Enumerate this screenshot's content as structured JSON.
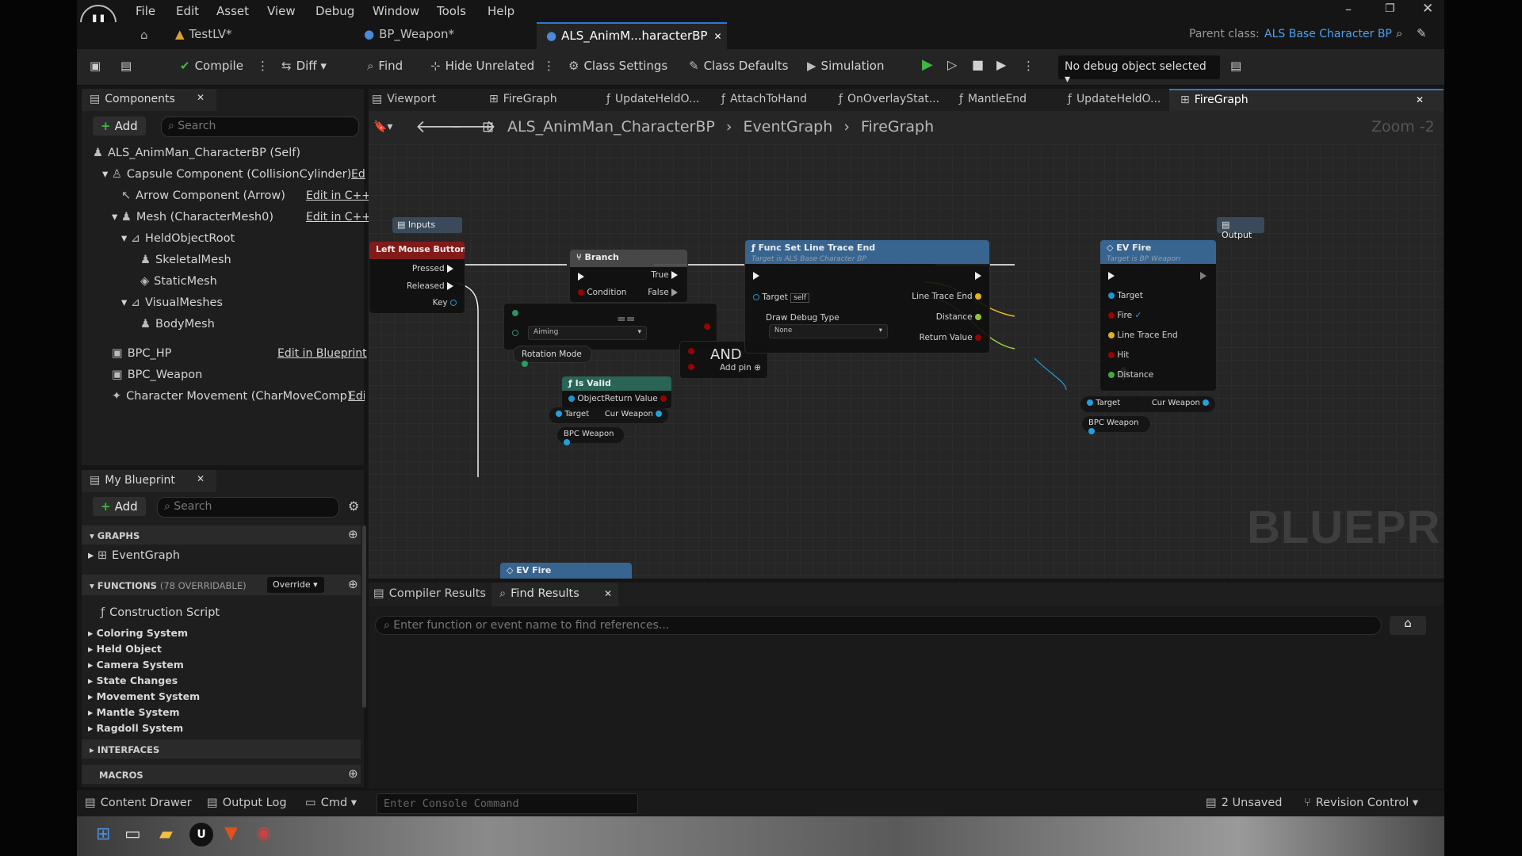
{
  "menu": [
    "File",
    "Edit",
    "Asset",
    "View",
    "Debug",
    "Window",
    "Tools",
    "Help"
  ],
  "tabs": {
    "home": "",
    "testlv": "TestLV*",
    "bp_weapon": "BP_Weapon*",
    "als": "ALS_AnimM...haracterBP",
    "parent_label": "Parent class:",
    "parent_value": "ALS Base Character BP"
  },
  "toolbar": {
    "compile": "Compile",
    "diff": "Diff",
    "find": "Find",
    "hide_unrelated": "Hide Unrelated",
    "class_settings": "Class Settings",
    "class_defaults": "Class Defaults",
    "simulation": "Simulation",
    "debug_object": "No debug object selected"
  },
  "components": {
    "title": "Components",
    "add": "Add",
    "search_placeholder": "Search",
    "items": [
      {
        "label": "ALS_AnimMan_CharacterBP (Self)",
        "action": ""
      },
      {
        "label": "Capsule Component (CollisionCylinder)",
        "action": "Ed"
      },
      {
        "label": "Arrow Component (Arrow)",
        "action": "Edit in C++"
      },
      {
        "label": "Mesh (CharacterMesh0)",
        "action": "Edit in C++"
      },
      {
        "label": "HeldObjectRoot",
        "action": ""
      },
      {
        "label": "SkeletalMesh",
        "action": ""
      },
      {
        "label": "StaticMesh",
        "action": ""
      },
      {
        "label": "VisualMeshes",
        "action": ""
      },
      {
        "label": "BodyMesh",
        "action": ""
      },
      {
        "label": "BPC_HP",
        "action": "Edit in Blueprint"
      },
      {
        "label": "BPC_Weapon",
        "action": ""
      },
      {
        "label": "Character Movement (CharMoveComp)",
        "action": "Edi"
      }
    ]
  },
  "myblueprint": {
    "title": "My Blueprint",
    "add": "Add",
    "search_placeholder": "Search",
    "graphs": "GRAPHS",
    "eventgraph": "EventGraph",
    "functions": "FUNCTIONS",
    "functions_count": "(78 OVERRIDABLE)",
    "override": "Override",
    "construction": "Construction Script",
    "categories": [
      "Coloring System",
      "Held Object",
      "Camera System",
      "State Changes",
      "Movement System",
      "Mantle System",
      "Ragdoll System"
    ],
    "interfaces": "INTERFACES",
    "macros": "MACROS"
  },
  "graph_tabs": [
    "Viewport",
    "FireGraph",
    "UpdateHeldO...",
    "AttachToHand",
    "OnOverlayStat...",
    "MantleEnd",
    "UpdateHeldO...",
    "FireGraph"
  ],
  "breadcrumb": {
    "a": "ALS_AnimMan_CharacterBP",
    "b": "EventGraph",
    "c": "FireGraph",
    "zoom": "Zoom -2"
  },
  "nodes": {
    "inputs": "Inputs",
    "outputs": "Output",
    "lmb": {
      "title": "Left Mouse Button",
      "pressed": "Pressed",
      "released": "Released",
      "key": "Key"
    },
    "branch": {
      "title": "Branch",
      "true": "True",
      "condition": "Condition",
      "false": "False"
    },
    "aiming": "Aiming",
    "rotation_mode": "Rotation Mode",
    "and": {
      "title": "AND",
      "add_pin": "Add pin"
    },
    "isvalid": {
      "title": "Is Valid",
      "object": "Object",
      "return": "Return Value",
      "target": "Target",
      "cur_weapon": "Cur Weapon",
      "bpc_weapon": "BPC Weapon"
    },
    "trace": {
      "title": "Func Set Line Trace End",
      "subtitle": "Target is ALS Base Character BP",
      "target": "Target",
      "self": "self",
      "draw_debug": "Draw Debug Type",
      "none": "None",
      "line_trace_end": "Line Trace End",
      "distance": "Distance",
      "return_value": "Return Value"
    },
    "evfire": {
      "title": "EV Fire",
      "subtitle": "Target is BP Weapon",
      "target": "Target",
      "fire": "Fire",
      "line_trace_end": "Line Trace End",
      "hit": "Hit",
      "distance": "Distance"
    },
    "getter": {
      "target": "Target",
      "cur_weapon": "Cur Weapon",
      "bpc_weapon": "BPC Weapon"
    },
    "evfire2": "EV Fire",
    "watermark": "BLUEPRINT"
  },
  "bottom": {
    "compiler_results": "Compiler Results",
    "find_results": "Find Results",
    "find_placeholder": "Enter function or event name to find references..."
  },
  "status": {
    "content_drawer": "Content Drawer",
    "output_log": "Output Log",
    "cmd": "Cmd",
    "console_placeholder": "Enter Console Command",
    "unsaved": "2 Unsaved",
    "revision": "Revision Control"
  },
  "colors": {
    "exec": "#ffffff",
    "object": "#1fa0e0",
    "bool": "#a00000",
    "float": "#9bd13a",
    "vector": "#f0c020",
    "green": "#3fb83f",
    "accent": "#2a7ad6"
  }
}
